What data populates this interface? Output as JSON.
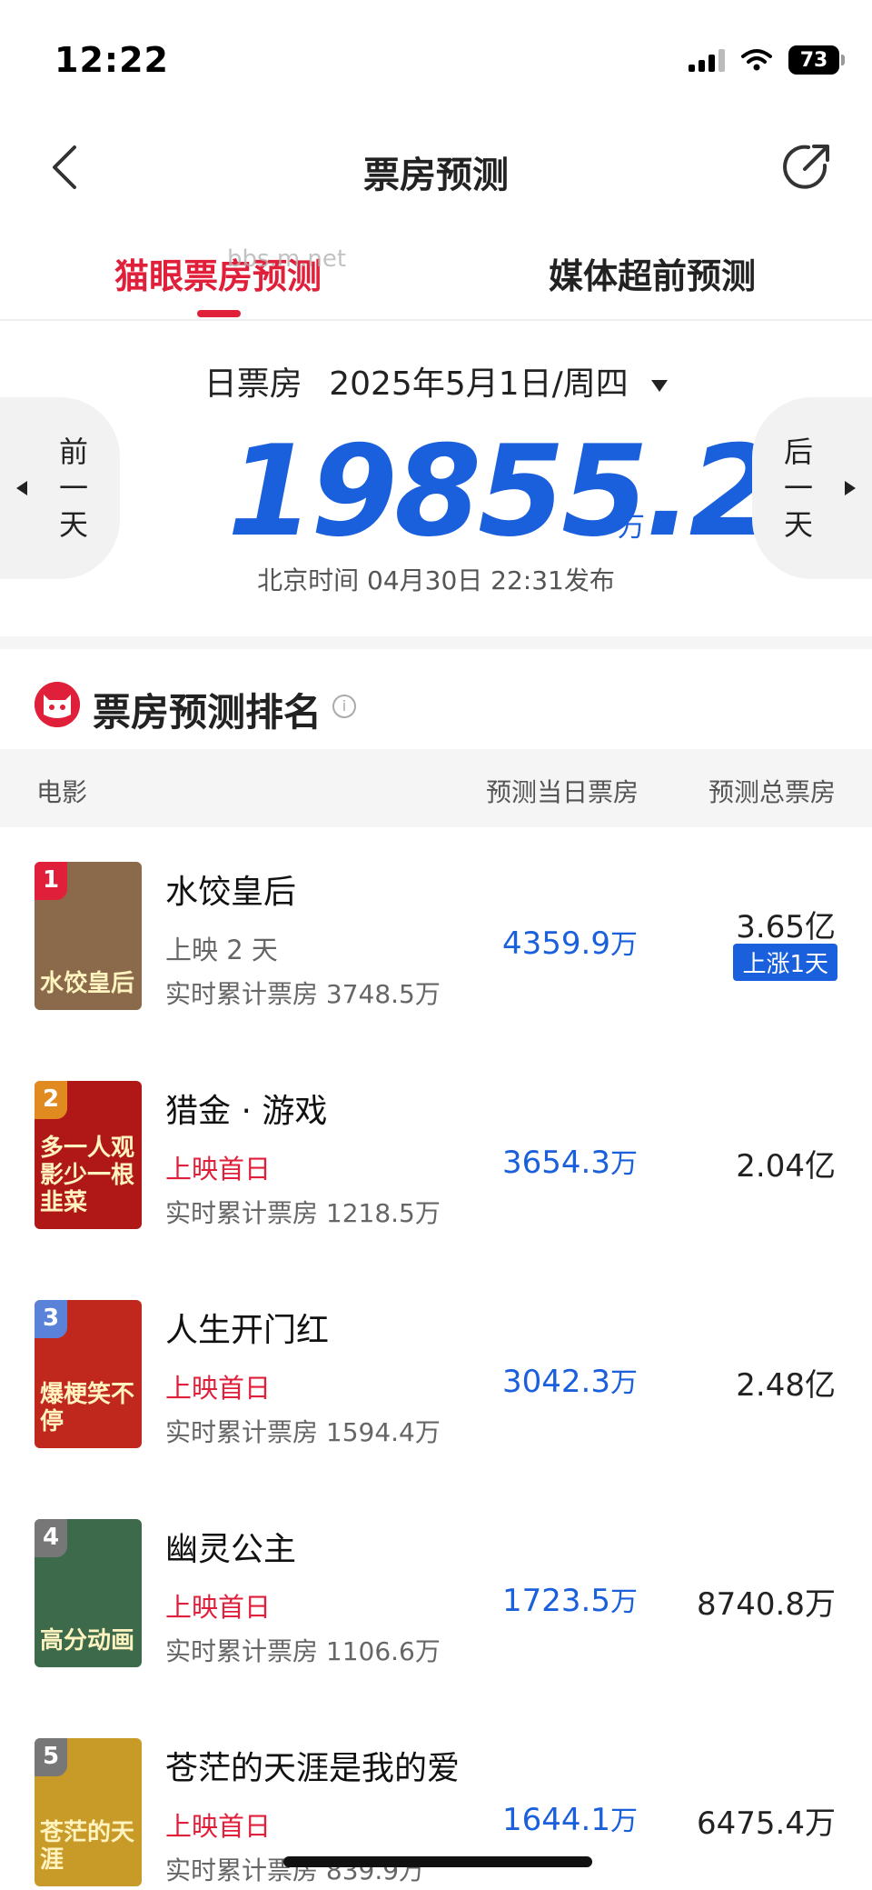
{
  "status_bar": {
    "time": "12:22",
    "battery": "73"
  },
  "nav": {
    "title": "票房预测"
  },
  "tabs": [
    {
      "label": "猫眼票房预测",
      "active": true
    },
    {
      "label": "媒体超前预测",
      "active": false
    }
  ],
  "watermark": "bbs.m.net",
  "summary": {
    "label": "日票房",
    "date": "2025年5月1日/周四",
    "value": "19855.2",
    "unit": "万",
    "publish": "北京时间  04月30日  22:31发布",
    "prev_day": "前一天",
    "next_day": "后一天"
  },
  "section": {
    "title": "票房预测排名",
    "info": "i"
  },
  "table_header": {
    "movie": "电影",
    "daily": "预测当日票房",
    "total": "预测总票房"
  },
  "movies": [
    {
      "rank": "1",
      "title": "水饺皇后",
      "release": "上映 2 天",
      "first_day": false,
      "cumulative": "实时累计票房 3748.5万",
      "daily": "4359.9",
      "daily_unit": "万",
      "total": "3.65亿",
      "tag": "上涨1天",
      "poster_text": "水饺皇后",
      "poster_bg": "#8a6a4a",
      "badge_color": "#e0203a"
    },
    {
      "rank": "2",
      "title": "猎金 · 游戏",
      "release": "上映首日",
      "first_day": true,
      "cumulative": "实时累计票房 1218.5万",
      "daily": "3654.3",
      "daily_unit": "万",
      "total": "2.04亿",
      "tag": "",
      "poster_text": "多一人观影少一根韭菜",
      "poster_bg": "#b01818",
      "badge_color": "#e08a20"
    },
    {
      "rank": "3",
      "title": "人生开门红",
      "release": "上映首日",
      "first_day": true,
      "cumulative": "实时累计票房 1594.4万",
      "daily": "3042.3",
      "daily_unit": "万",
      "total": "2.48亿",
      "tag": "",
      "poster_text": "爆梗笑不停",
      "poster_bg": "#c0281e",
      "badge_color": "#5a82d8"
    },
    {
      "rank": "4",
      "title": "幽灵公主",
      "release": "上映首日",
      "first_day": true,
      "cumulative": "实时累计票房 1106.6万",
      "daily": "1723.5",
      "daily_unit": "万",
      "total": "8740.8万",
      "tag": "",
      "poster_text": "高分动画",
      "poster_bg": "#3d6a4a",
      "badge_color": "#777777"
    },
    {
      "rank": "5",
      "title": "苍茫的天涯是我的爱",
      "release": "上映首日",
      "first_day": true,
      "cumulative": "实时累计票房 839.9万",
      "daily": "1644.1",
      "daily_unit": "万",
      "total": "6475.4万",
      "tag": "",
      "poster_text": "苍茫的天涯",
      "poster_bg": "#c89a28",
      "badge_color": "#777777"
    }
  ],
  "colors": {
    "accent": "#e0203a",
    "blue": "#1a5fdc"
  }
}
